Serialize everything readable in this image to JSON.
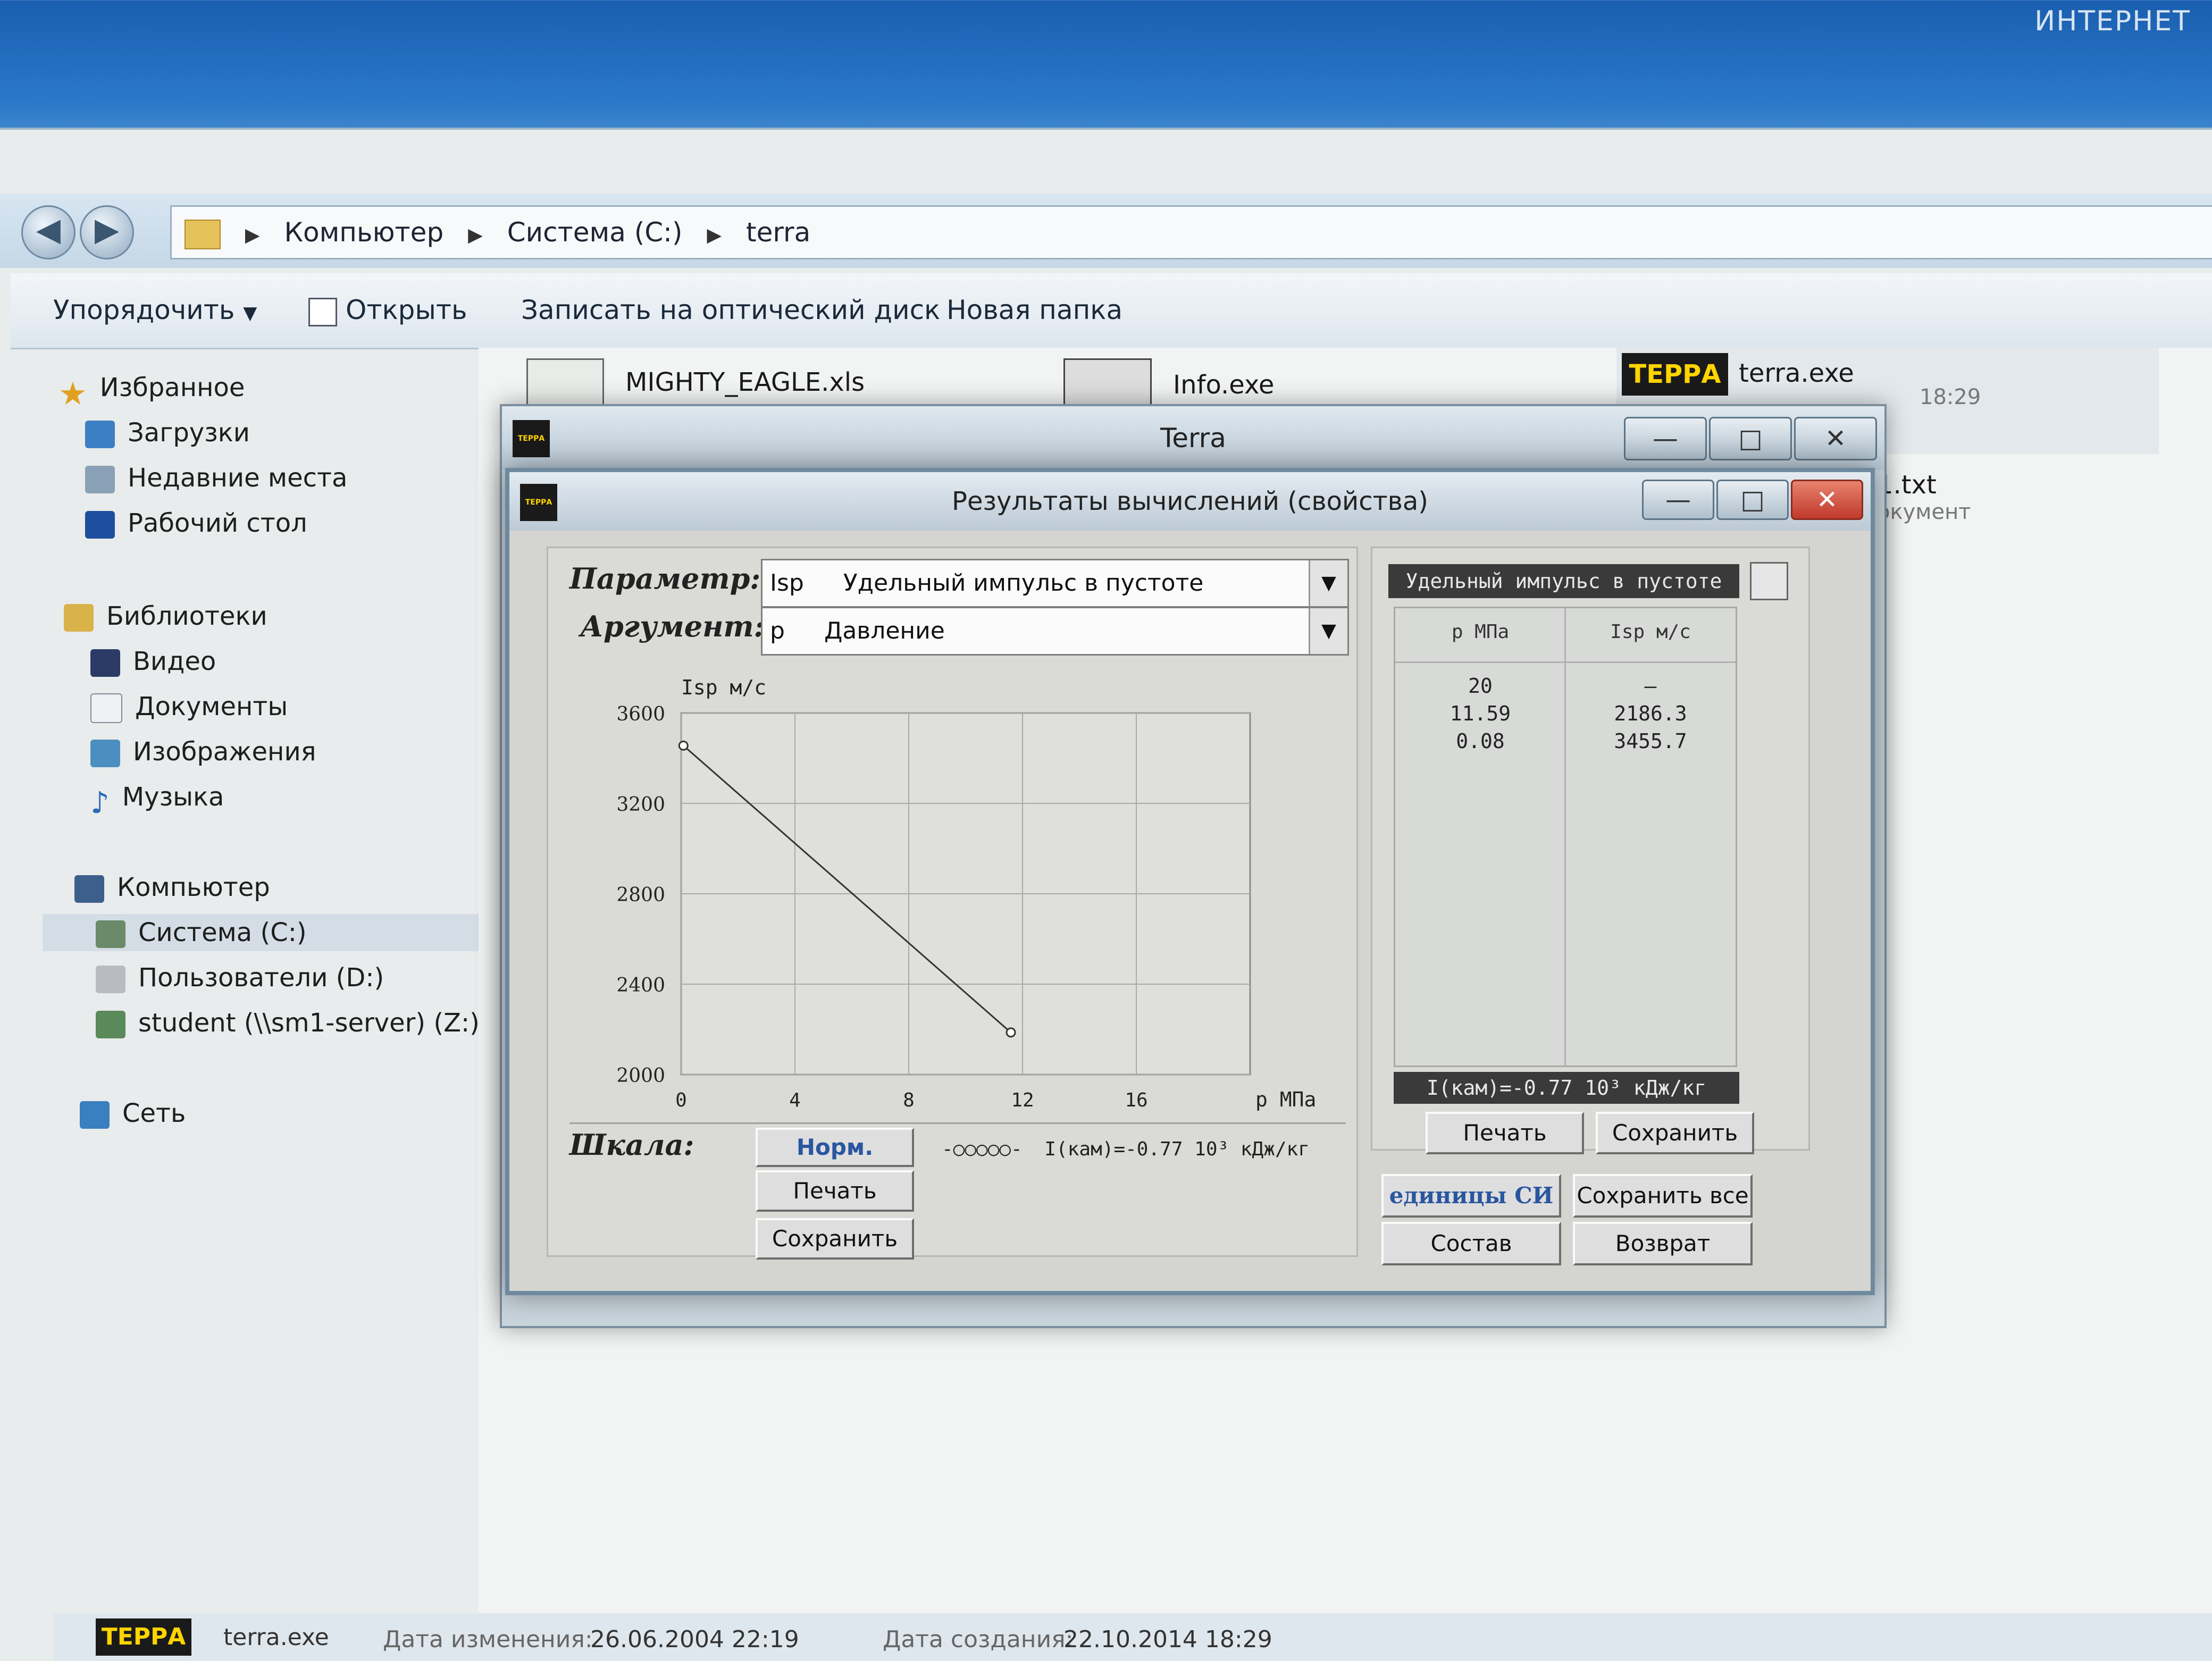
{
  "os": {
    "corner_label": "ИНТЕРНЕТ"
  },
  "explorer": {
    "breadcrumb": [
      "Компьютер",
      "Система (C:)",
      "terra"
    ],
    "toolbar": {
      "organize": "Упорядочить",
      "open": "Открыть",
      "burn": "Записать на оптический диск",
      "new_folder": "Новая папка"
    },
    "sidebar": {
      "favorites": "Избранное",
      "fav_items": [
        "Загрузки",
        "Недавние места",
        "Рабочий стол"
      ],
      "libraries": "Библиотеки",
      "lib_items": [
        "Видео",
        "Документы",
        "Изображения",
        "Музыка"
      ],
      "computer": "Компьютер",
      "comp_items": [
        "Система (C:)",
        "Пользователи (D:)",
        "student (\\\\sm1-server) (Z:)"
      ],
      "network": "Сеть"
    },
    "files": [
      {
        "name": "MIGHTY_EAGLE.xls"
      },
      {
        "name": "Info.exe"
      },
      {
        "name": "terra.exe",
        "time": "18:29"
      },
      {
        "name": "1.txt",
        "type": "окумент"
      }
    ],
    "status": {
      "logo": "ТЕРРА",
      "name": "terra.exe",
      "modified_label": "Дата изменения:",
      "modified": "26.06.2004 22:19",
      "created_label": "Дата создания:",
      "created": "22.10.2014 18:29"
    }
  },
  "terra_window": {
    "title": "Terra",
    "logo": "ТЕРРА",
    "buttons": {
      "minimize": "—",
      "maximize": "□",
      "close": "✕"
    }
  },
  "results": {
    "title": "Результаты вычислений (свойства)",
    "param_label": "Параметр:",
    "param_code": "Isp",
    "param_value": "Удельный импульс в пустоте",
    "arg_label": "Аргумент:",
    "arg_code": "p",
    "arg_value": "Давление",
    "scale_label": "Шкала:",
    "btn_norm": "Норм.",
    "btn_print": "Печать",
    "btn_save": "Сохранить",
    "legend_marker": "-○○○○○-",
    "legend_text": "I(кам)=-0.77 10³ кДж/кг",
    "right_panel": {
      "title": "Удельный импульс в пустоте",
      "col1": "p МПа",
      "col2": "Isp м/с",
      "rows": [
        [
          "20",
          "–"
        ],
        [
          "11.59",
          "2186.3"
        ],
        [
          "0.08",
          "3455.7"
        ]
      ],
      "footer": "I(кам)=-0.77 10³ кДж/кг",
      "btn_print": "Печать",
      "btn_save": "Сохранить"
    },
    "bottom_buttons": {
      "units": "единицы СИ",
      "save_all": "Сохранить все",
      "composition": "Состав",
      "back": "Возврат"
    }
  },
  "chart_data": {
    "type": "line",
    "title": "",
    "ylabel": "Isp м/с",
    "xlabel": "p МПа",
    "xlim": [
      0,
      20
    ],
    "ylim": [
      2000,
      3600
    ],
    "x_ticks": [
      0,
      4,
      8,
      12,
      16
    ],
    "y_ticks": [
      3600,
      3200,
      2800,
      2400,
      2000
    ],
    "grid": true,
    "series": [
      {
        "x": [
          0.08,
          11.59
        ],
        "y": [
          3455.7,
          2186.3
        ]
      }
    ]
  }
}
